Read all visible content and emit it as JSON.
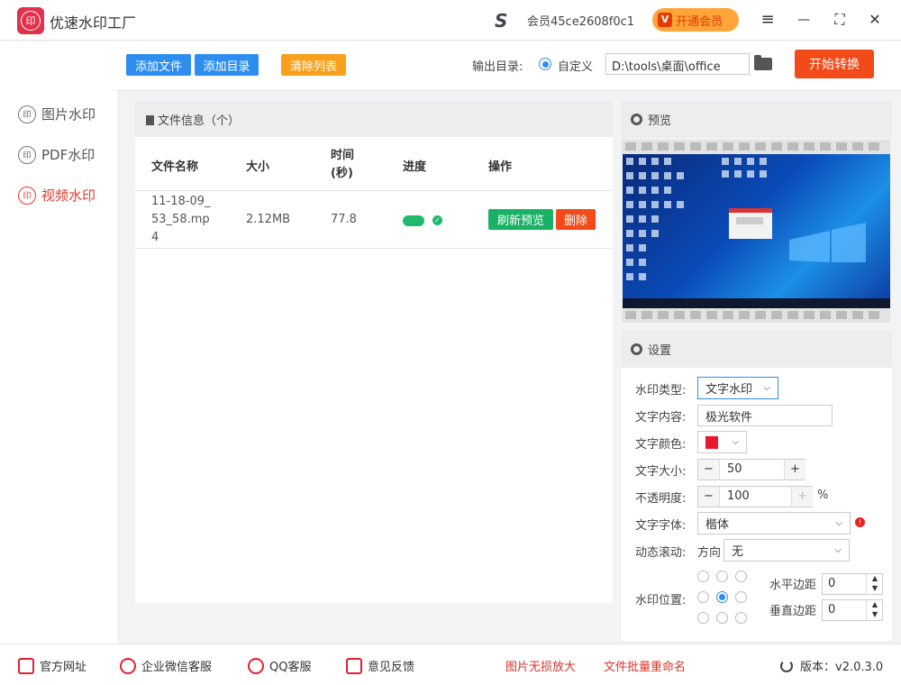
{
  "app": {
    "title": "优速水印工厂",
    "logo_text": "印"
  },
  "account": {
    "member": "会员45ce2608f0c1",
    "vip_button": "开通会员",
    "vip_icon": "V"
  },
  "window_controls": {
    "menu": "≡",
    "minimize": "—",
    "maximize": "⛶",
    "close": "✕"
  },
  "sidebar": {
    "items": [
      {
        "label": "图片水印",
        "icon": "印"
      },
      {
        "label": "PDF水印",
        "icon": "印"
      },
      {
        "label": "视频水印",
        "icon": "印"
      }
    ]
  },
  "toolbar": {
    "add_file": "添加文件",
    "add_dir": "添加目录",
    "clear_list": "清除列表",
    "output_label": "输出目录:",
    "custom_label": "自定义",
    "output_path": "D:\\tools\\桌面\\office",
    "start": "开始转换"
  },
  "file_panel": {
    "title": "文件信息（个）",
    "columns": [
      "文件名称",
      "大小",
      "时间\n(秒)",
      "进度",
      "操作"
    ],
    "rows": [
      {
        "name": "11-18-09_\n53_58.mp\n4",
        "size": "2.12MB",
        "time": "77.8",
        "actions": [
          "刷新预览",
          "删除"
        ]
      }
    ]
  },
  "preview": {
    "title": "预览"
  },
  "settings": {
    "title": "设置",
    "type_label": "水印类型:",
    "type_value": "文字水印",
    "text_label": "文字内容:",
    "text_value": "极光软件",
    "color_label": "文字颜色:",
    "color_value": "#e8192c",
    "size_label": "文字大小:",
    "size_value": "50",
    "opacity_label": "不透明度:",
    "opacity_value": "100",
    "opacity_unit": "%",
    "font_label": "文字字体:",
    "font_value": "楷体",
    "scroll_label": "动态滚动:",
    "direction_label": "方向",
    "direction_value": "无",
    "position_label": "水印位置:",
    "position_selected": "middle-center",
    "hmargin_label": "水平边距",
    "hmargin_value": "0",
    "vmargin_label": "垂直边距",
    "vmargin_value": "0"
  },
  "footer": {
    "website": "官方网址",
    "wechat": "企业微信客服",
    "qq": "QQ客服",
    "feedback": "意见反馈",
    "upscale": "图片无损放大",
    "rename": "文件批量重命名",
    "version": "版本：v2.0.3.0"
  }
}
